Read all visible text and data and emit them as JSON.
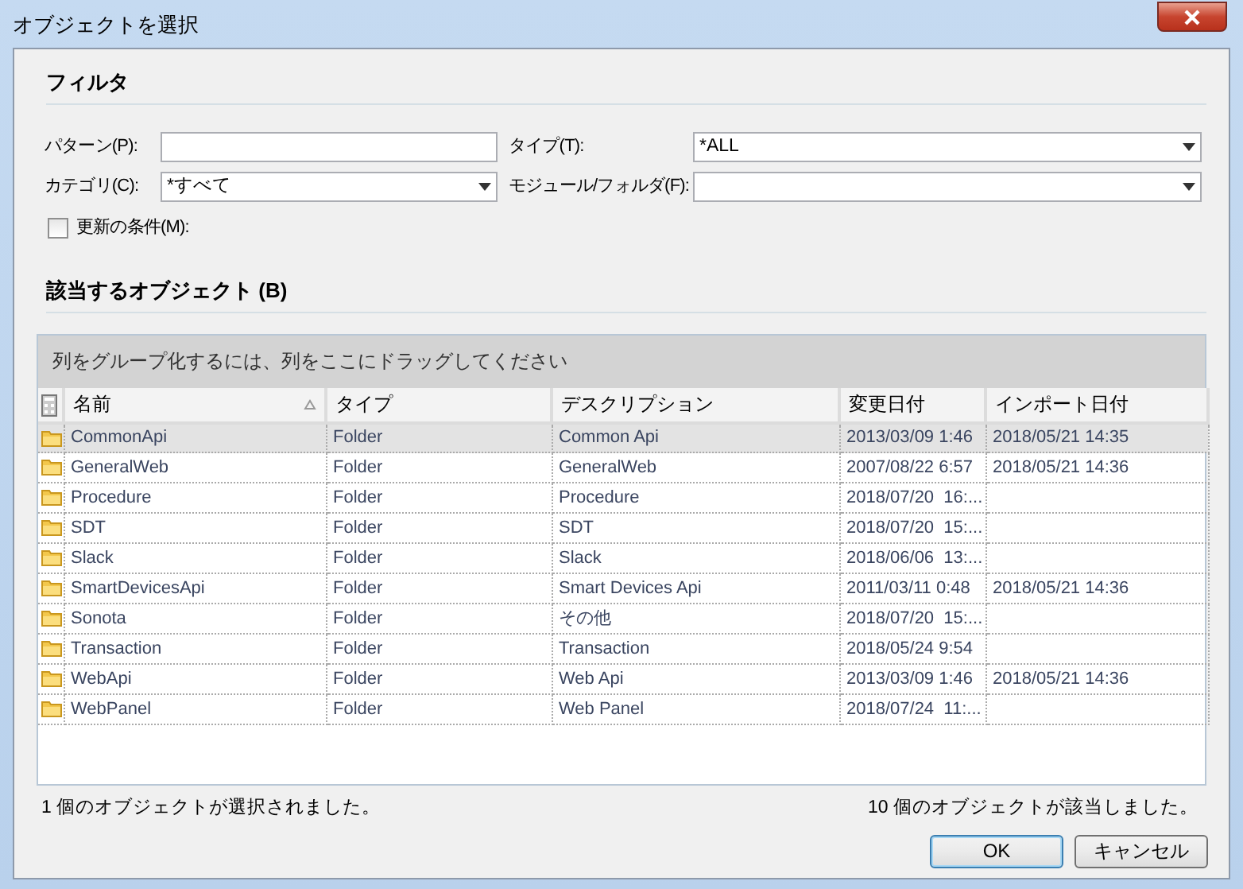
{
  "window": {
    "title": "オブジェクトを選択"
  },
  "filter": {
    "heading": "フィルタ",
    "fields": [
      {
        "kind": "text",
        "label": "パターン(P):"
      },
      {
        "kind": "combo",
        "label": "タイプ(T):",
        "value": "*ALL"
      },
      {
        "kind": "combo",
        "label": "カテゴリ(C):",
        "value": "*すべて"
      },
      {
        "kind": "combo",
        "label": "モジュール/フォルダ(F):"
      }
    ],
    "checkbox": {
      "label": "更新の条件(M):",
      "checked": false
    }
  },
  "results": {
    "heading": "該当するオブジェクト (B)",
    "group_panel": "列をグループ化するには、列をここにドラッグしてください",
    "columns": [
      {
        "label": "名前",
        "sorted": true
      },
      {
        "label": "タイプ"
      },
      {
        "label": "デスクリプション"
      },
      {
        "label": "変更日付"
      },
      {
        "label": "インポート日付"
      }
    ],
    "rows": [
      {
        "selected": true,
        "name": "CommonApi",
        "type": "Folder",
        "description": "Common Api",
        "modified": "2013/03/09 1:46",
        "imported": "2018/05/21 14:35"
      },
      {
        "selected": false,
        "name": "GeneralWeb",
        "type": "Folder",
        "description": "GeneralWeb",
        "modified": "2007/08/22 6:57",
        "imported": "2018/05/21 14:36"
      },
      {
        "selected": false,
        "name": "Procedure",
        "type": "Folder",
        "description": "Procedure",
        "modified": "2018/07/20  16:..."
      },
      {
        "selected": false,
        "name": "SDT",
        "type": "Folder",
        "description": "SDT",
        "modified": "2018/07/20  15:..."
      },
      {
        "selected": false,
        "name": "Slack",
        "type": "Folder",
        "description": "Slack",
        "modified": "2018/06/06  13:..."
      },
      {
        "selected": false,
        "name": "SmartDevicesApi",
        "type": "Folder",
        "description": "Smart Devices Api",
        "modified": "2011/03/11 0:48",
        "imported": "2018/05/21 14:36"
      },
      {
        "selected": false,
        "name": "Sonota",
        "type": "Folder",
        "description": "その他",
        "modified": "2018/07/20  15:..."
      },
      {
        "selected": false,
        "name": "Transaction",
        "type": "Folder",
        "description": "Transaction",
        "modified": "2018/05/24 9:54"
      },
      {
        "selected": false,
        "name": "WebApi",
        "type": "Folder",
        "description": "Web Api",
        "modified": "2013/03/09 1:46",
        "imported": "2018/05/21 14:36"
      },
      {
        "selected": false,
        "name": "WebPanel",
        "type": "Folder",
        "description": "Web Panel",
        "modified": "2018/07/24  11:..."
      }
    ]
  },
  "status": {
    "selected_count": "1 個のオブジェクトが選択されました。",
    "match_count": "10 個のオブジェクトが該当しました。"
  },
  "buttons": [
    {
      "label": "OK",
      "default": true
    },
    {
      "label": "キャンセル",
      "default": false
    }
  ]
}
